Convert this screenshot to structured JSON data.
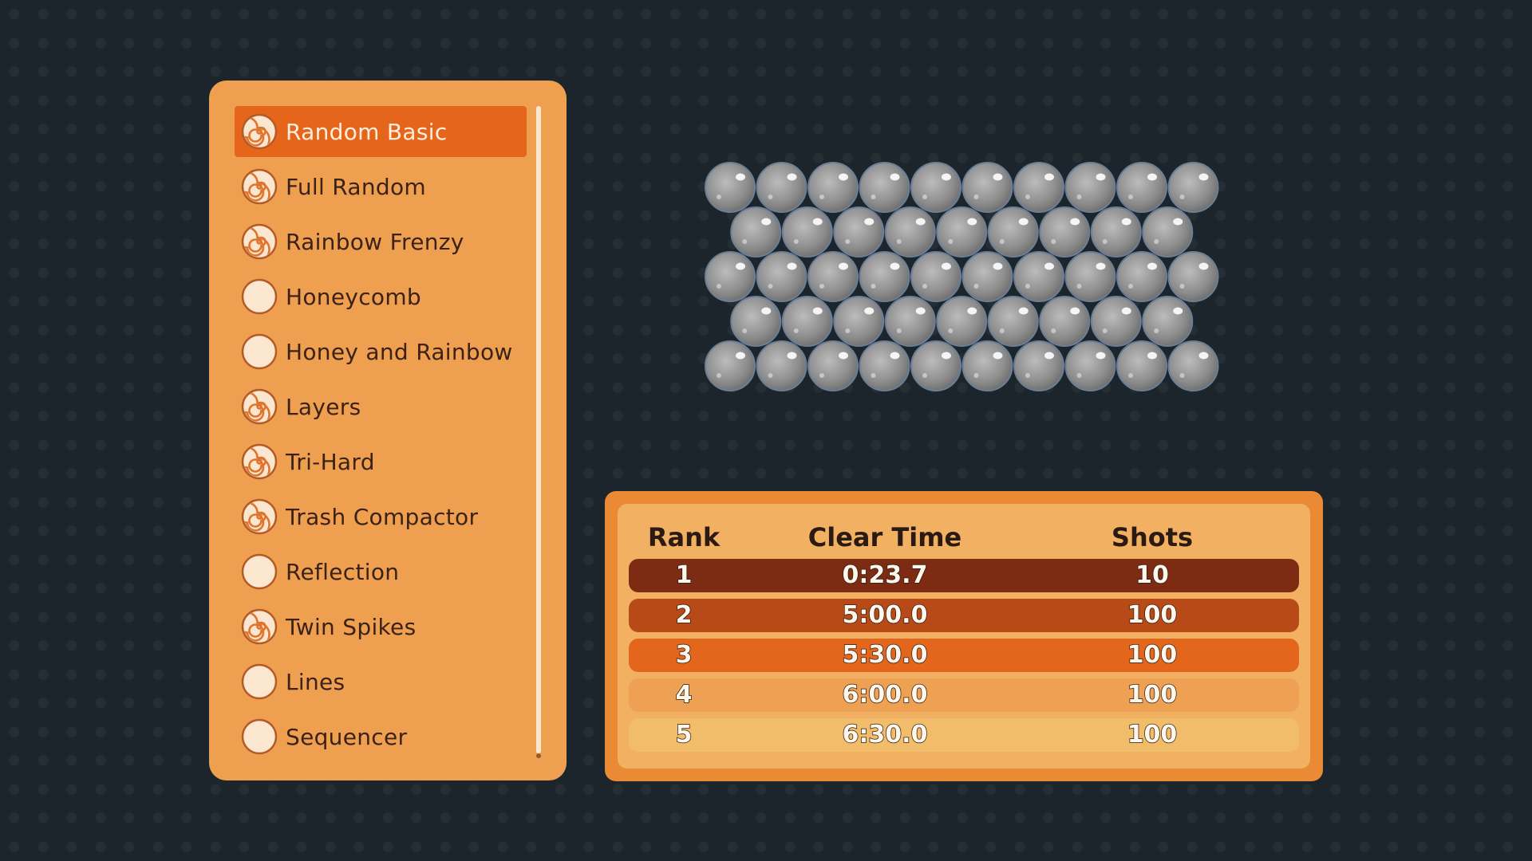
{
  "levels": {
    "selected_index": 0,
    "items": [
      {
        "label": "Random Basic",
        "icon": "spiral-icon"
      },
      {
        "label": "Full Random",
        "icon": "spiral-icon"
      },
      {
        "label": "Rainbow Frenzy",
        "icon": "spiral-icon"
      },
      {
        "label": "Honeycomb",
        "icon": "empty-circle-icon"
      },
      {
        "label": "Honey and Rainbow",
        "icon": "empty-circle-icon"
      },
      {
        "label": "Layers",
        "icon": "spiral-icon"
      },
      {
        "label": "Tri-Hard",
        "icon": "spiral-icon"
      },
      {
        "label": "Trash Compactor",
        "icon": "spiral-icon"
      },
      {
        "label": "Reflection",
        "icon": "empty-circle-icon"
      },
      {
        "label": "Twin Spikes",
        "icon": "spiral-icon"
      },
      {
        "label": "Lines",
        "icon": "empty-circle-icon"
      },
      {
        "label": "Sequencer",
        "icon": "empty-circle-icon"
      }
    ]
  },
  "preview": {
    "bubble_color": "#9a9a9a",
    "rows": [
      {
        "count": 10,
        "offset": false
      },
      {
        "count": 9,
        "offset": true
      },
      {
        "count": 10,
        "offset": false
      },
      {
        "count": 9,
        "offset": true
      },
      {
        "count": 10,
        "offset": false
      }
    ]
  },
  "leaderboard": {
    "headers": {
      "rank": "Rank",
      "time": "Clear Time",
      "shots": "Shots"
    },
    "rows": [
      {
        "rank": "1",
        "time": "0:23.7",
        "shots": "10"
      },
      {
        "rank": "2",
        "time": "5:00.0",
        "shots": "100"
      },
      {
        "rank": "3",
        "time": "5:30.0",
        "shots": "100"
      },
      {
        "rank": "4",
        "time": "6:00.0",
        "shots": "100"
      },
      {
        "rank": "5",
        "time": "6:30.0",
        "shots": "100"
      }
    ]
  },
  "colors": {
    "background": "#1c252b",
    "panel": "#eea050",
    "selected": "#e5661b",
    "rank1": "#7e2b14",
    "rank2": "#b84a17",
    "rank3": "#e4661c",
    "rank4": "#eea152",
    "rank5": "#f1bd6b"
  }
}
